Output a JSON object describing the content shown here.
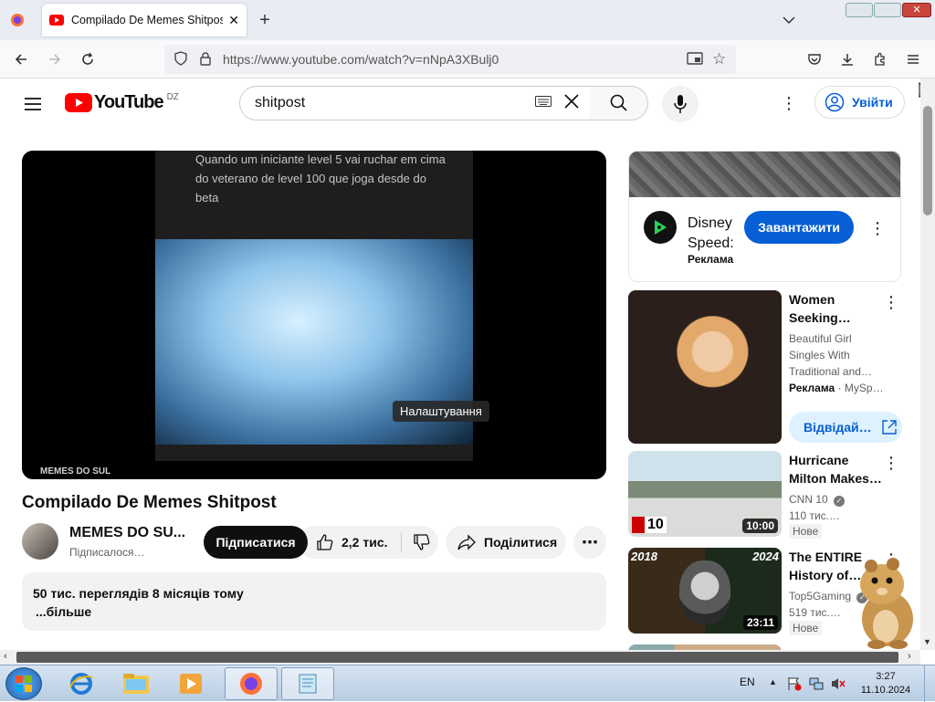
{
  "browser": {
    "tab_title": "Compilado De Memes Shitpost",
    "new_tab": "+",
    "url": "https://www.youtube.com/watch?v=nNpA3XBulj0"
  },
  "youtube": {
    "logo_text": "YouTube",
    "country": "DZ",
    "search_value": "shitpost",
    "signin_label": "Увійти"
  },
  "video": {
    "caption": "Quando um iniciante level 5 vai ruchar em cima do veterano de level 100 que joga desde do beta",
    "tooltip": "Налаштування",
    "watermark": "MEMES DO SUL",
    "title": "Compilado De Memes Shitpost",
    "channel": "MEMES DO SU...",
    "subscribers": "Підписалося…",
    "subscribe_label": "Підписатися",
    "likes": "2,2 тис.",
    "share_label": "Поділитися",
    "views_date": "50 тис. переглядів  8 місяців тому",
    "more": "...більше"
  },
  "ad": {
    "title_line1": "Disney",
    "title_line2": "Speed:",
    "ad_label": "Реклама",
    "download_label": "Завантажити"
  },
  "recommendations": [
    {
      "title": "Women Seeking…",
      "meta1": "Beautiful Girl",
      "meta2": "Singles With",
      "meta3": "Traditional and…",
      "ad_label": "Реклама",
      "ad_source": "· MySp…",
      "visit_label": "Відвідай…"
    },
    {
      "title": "Hurricane Milton Makes…",
      "channel": "CNN 10",
      "views": "110 тис.…",
      "badge": "Нове",
      "duration": "10:00"
    },
    {
      "title": "The ENTIRE History of…",
      "channel": "Top5Gaming",
      "views": "519 тис.…",
      "badge": "Нове",
      "duration": "23:11",
      "year_left": "2018",
      "year_right": "2024"
    }
  ],
  "taskbar": {
    "lang": "EN",
    "time": "3:27",
    "date": "11.10.2024"
  }
}
